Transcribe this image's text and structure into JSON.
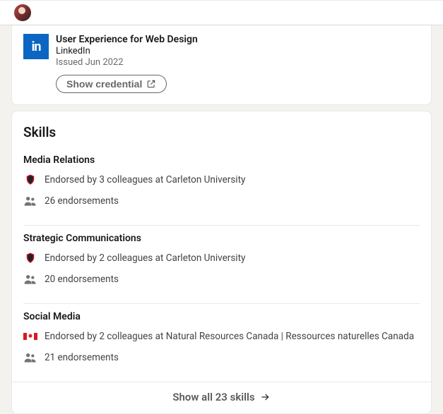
{
  "certification": {
    "title": "User Experience for Web Design",
    "issuer": "LinkedIn",
    "issued": "Issued Jun 2022",
    "button": "Show credential"
  },
  "skills": {
    "heading": "Skills",
    "items": [
      {
        "name": "Media Relations",
        "org_endorsement": "Endorsed by 3 colleagues at Carleton University",
        "count_text": "26 endorsements",
        "org": "carleton"
      },
      {
        "name": "Strategic Communications",
        "org_endorsement": "Endorsed by 2 colleagues at Carleton University",
        "count_text": "20 endorsements",
        "org": "carleton"
      },
      {
        "name": "Social Media",
        "org_endorsement": "Endorsed by 2 colleagues at Natural Resources Canada | Ressources naturelles Canada",
        "count_text": "21 endorsements",
        "org": "nrcan"
      }
    ],
    "show_all": "Show all 23 skills"
  }
}
